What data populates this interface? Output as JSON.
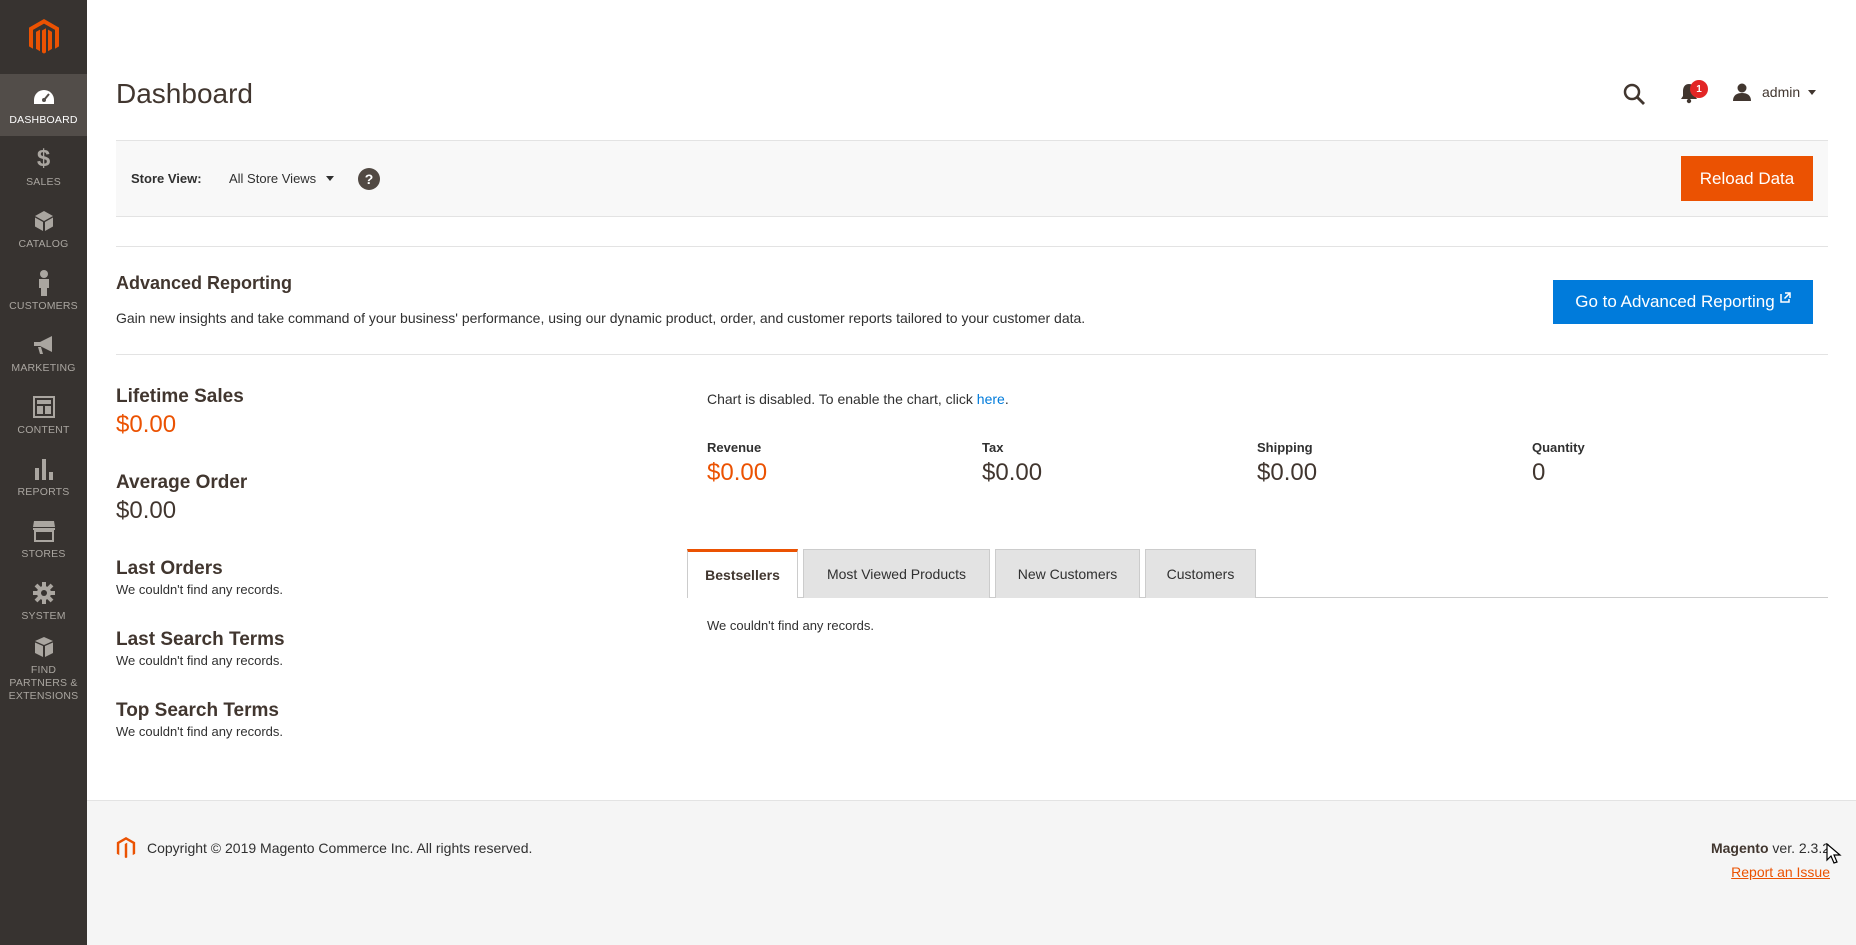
{
  "colors": {
    "accent": "#eb5202",
    "link": "#007bdb",
    "sidebar": "#373330"
  },
  "sidebar": {
    "logo_icon": "magento-logo-icon",
    "items": [
      {
        "label": "DASHBOARD",
        "icon": "dashboard-gauge-icon",
        "active": true
      },
      {
        "label": "SALES",
        "icon": "dollar-icon"
      },
      {
        "label": "CATALOG",
        "icon": "box-icon"
      },
      {
        "label": "CUSTOMERS",
        "icon": "person-icon"
      },
      {
        "label": "MARKETING",
        "icon": "megaphone-icon"
      },
      {
        "label": "CONTENT",
        "icon": "layout-icon"
      },
      {
        "label": "REPORTS",
        "icon": "bar-chart-icon"
      },
      {
        "label": "STORES",
        "icon": "storefront-icon"
      },
      {
        "label": "SYSTEM",
        "icon": "gear-icon"
      },
      {
        "label": "FIND PARTNERS & EXTENSIONS",
        "icon": "boxes-icon"
      }
    ]
  },
  "header": {
    "title": "Dashboard",
    "notifications_count": "1",
    "user": "admin"
  },
  "store_view": {
    "label": "Store View:",
    "selected": "All Store Views",
    "help": "?",
    "reload": "Reload Data"
  },
  "advanced_reporting": {
    "title": "Advanced Reporting",
    "description": "Gain new insights and take command of your business' performance, using our dynamic product, order, and customer reports tailored to your customer data.",
    "button": "Go to Advanced Reporting"
  },
  "stats": {
    "lifetime_sales_label": "Lifetime Sales",
    "lifetime_sales_value": "$0.00",
    "average_order_label": "Average Order",
    "average_order_value": "$0.00",
    "last_orders_label": "Last Orders",
    "last_orders_empty": "We couldn't find any records.",
    "last_search_label": "Last Search Terms",
    "last_search_empty": "We couldn't find any records.",
    "top_search_label": "Top Search Terms",
    "top_search_empty": "We couldn't find any records."
  },
  "chart": {
    "message_prefix": "Chart is disabled. To enable the chart, click ",
    "message_link": "here",
    "message_suffix": "."
  },
  "totals": [
    {
      "label": "Revenue",
      "value": "$0.00"
    },
    {
      "label": "Tax",
      "value": "$0.00"
    },
    {
      "label": "Shipping",
      "value": "$0.00"
    },
    {
      "label": "Quantity",
      "value": "0"
    }
  ],
  "tabs": [
    {
      "label": "Bestsellers",
      "active": true
    },
    {
      "label": "Most Viewed Products"
    },
    {
      "label": "New Customers"
    },
    {
      "label": "Customers"
    }
  ],
  "tab_content": "We couldn't find any records.",
  "footer": {
    "copyright": "Copyright © 2019 Magento Commerce Inc. All rights reserved.",
    "brand": "Magento",
    "version": " ver. 2.3.2",
    "report": "Report an Issue"
  }
}
